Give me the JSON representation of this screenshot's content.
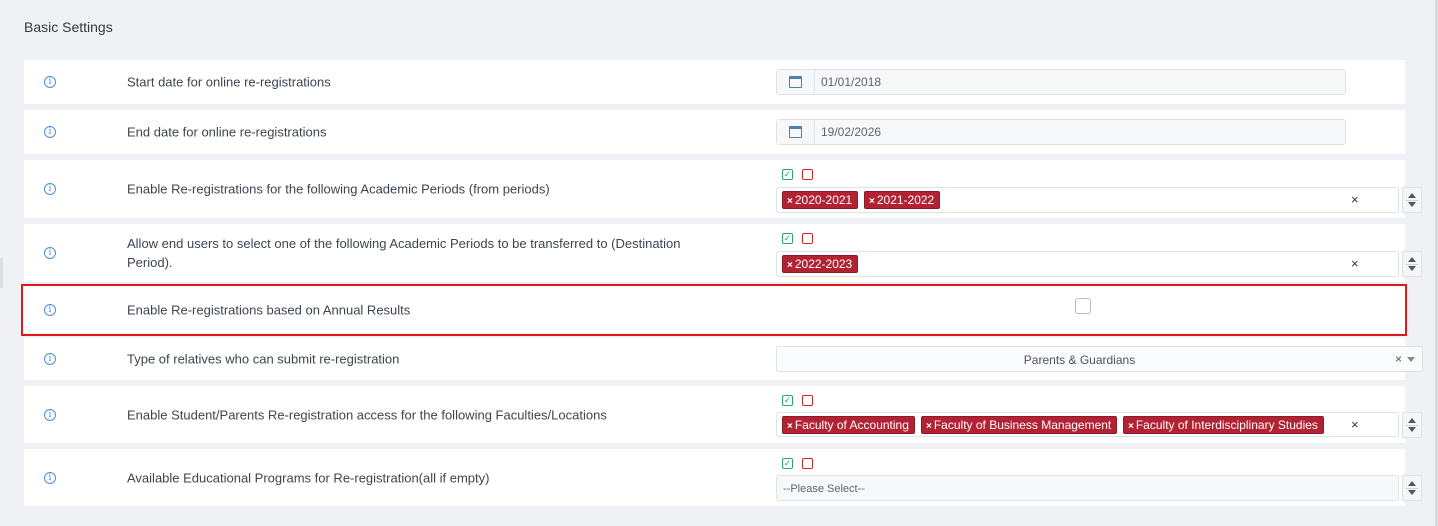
{
  "section": {
    "title": "Basic Settings"
  },
  "rows": [
    {
      "label": "Start date for online re-registrations",
      "value": "01/01/2018"
    },
    {
      "label": "End date for online re-registrations",
      "value": "19/02/2026"
    },
    {
      "label": "Enable Re-registrations for the following Academic Periods (from periods)",
      "tags": [
        "2020-2021",
        "2021-2022"
      ]
    },
    {
      "label": "Allow end users to select one of the following Academic Periods to be transferred to (Destination Period).",
      "tags": [
        "2022-2023"
      ]
    },
    {
      "label": "Enable Re-registrations based on Annual Results",
      "checked": false
    },
    {
      "label": "Type of relatives who can submit re-registration",
      "value": "Parents & Guardians"
    },
    {
      "label": "Enable Student/Parents Re-registration access for the following Faculties/Locations",
      "tags": [
        "Faculty of Accounting",
        "Faculty of Business Management",
        "Faculty of Interdisciplinary Studies"
      ]
    },
    {
      "label": "Available Educational Programs for Re-registration(all if empty)",
      "placeholder": "--Please Select--"
    }
  ],
  "icons": {
    "info": "info-circle-icon",
    "calendar": "calendar-icon",
    "select_all": "check-square-icon",
    "select_none": "empty-square-icon",
    "tag_remove": "×",
    "clear": "×"
  },
  "colors": {
    "tag": "#b22232",
    "highlight": "#e01818",
    "select_all": "#2aa86b",
    "select_none": "#c62828",
    "info": "#4a8fd8"
  }
}
